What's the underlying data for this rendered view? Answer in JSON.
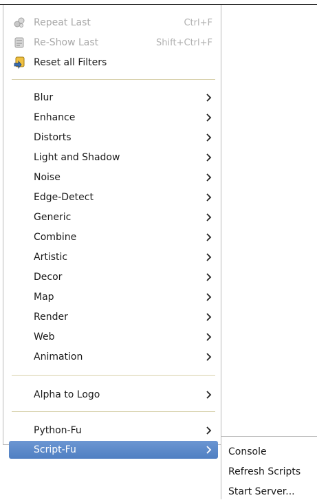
{
  "menu": {
    "top_items": [
      {
        "label": "Repeat Last",
        "accel": "Ctrl+F",
        "disabled": true,
        "icon": "repeat-icon"
      },
      {
        "label": "Re-Show Last",
        "accel": "Shift+Ctrl+F",
        "disabled": true,
        "icon": "reshow-icon"
      },
      {
        "label": "Reset all Filters",
        "accel": "",
        "disabled": false,
        "icon": "reset-filters-icon"
      }
    ],
    "filter_items": [
      {
        "label": "Blur"
      },
      {
        "label": "Enhance"
      },
      {
        "label": "Distorts"
      },
      {
        "label": "Light and Shadow"
      },
      {
        "label": "Noise"
      },
      {
        "label": "Edge-Detect"
      },
      {
        "label": "Generic"
      },
      {
        "label": "Combine"
      },
      {
        "label": "Artistic"
      },
      {
        "label": "Decor"
      },
      {
        "label": "Map"
      },
      {
        "label": "Render"
      },
      {
        "label": "Web"
      },
      {
        "label": "Animation"
      }
    ],
    "alpha_item": {
      "label": "Alpha to Logo"
    },
    "fu_items": [
      {
        "label": "Python-Fu",
        "selected": false
      },
      {
        "label": "Script-Fu",
        "selected": true
      }
    ]
  },
  "submenu": {
    "items": [
      {
        "label": "Console"
      },
      {
        "label": "Refresh Scripts"
      },
      {
        "label": "Start Server..."
      }
    ]
  },
  "colors": {
    "selection": "#5a88c8",
    "separator": "#d6cfa8",
    "disabled_text": "#a8a8a8"
  }
}
